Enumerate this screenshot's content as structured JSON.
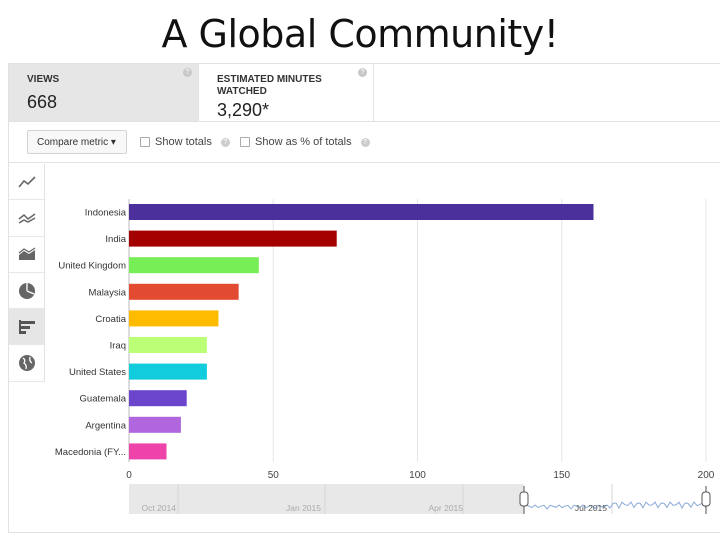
{
  "title": "A Global Community!",
  "metrics": [
    {
      "label": "VIEWS",
      "value": "668"
    },
    {
      "label_line1": "ESTIMATED MINUTES",
      "label_line2": "WATCHED",
      "value": "3,290*"
    }
  ],
  "controls": {
    "compare_metric": "Compare metric ▾",
    "show_totals": "Show totals",
    "show_pct": "Show as % of totals"
  },
  "sidebar": [
    "line-chart-icon",
    "compare-lines-icon",
    "area-chart-icon",
    "pie-chart-icon",
    "bar-chart-icon",
    "globe-icon"
  ],
  "timeline": {
    "labels": [
      "Oct 2014",
      "Jan 2015",
      "Apr 2015",
      "Jul 2015"
    ]
  },
  "chart_data": {
    "type": "bar",
    "orientation": "horizontal",
    "categories": [
      "Indonesia",
      "India",
      "United Kingdom",
      "Malaysia",
      "Croatia",
      "Iraq",
      "United States",
      "Guatemala",
      "Argentina",
      "Macedonia (FY..."
    ],
    "values": [
      161,
      72,
      45,
      38,
      31,
      27,
      27,
      20,
      18,
      13
    ],
    "colors": [
      "#4b2f9b",
      "#a50000",
      "#77ee55",
      "#e24a32",
      "#ffbb00",
      "#bbff77",
      "#11ccdd",
      "#6b45cc",
      "#b067dd",
      "#ee44aa"
    ],
    "xlim": [
      0,
      200
    ],
    "xticks": [
      0,
      50,
      100,
      150,
      200
    ],
    "grid": true,
    "ylabel": "",
    "xlabel": ""
  }
}
